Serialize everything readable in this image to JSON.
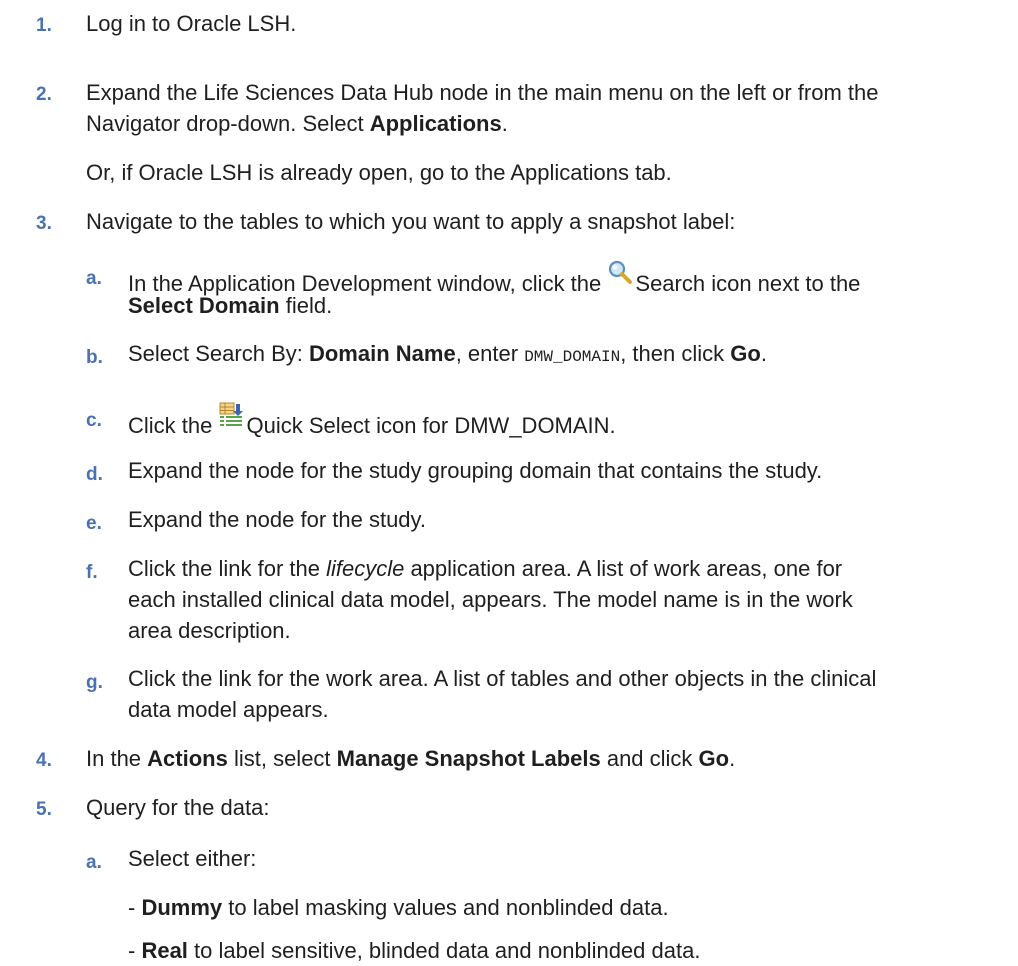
{
  "steps": [
    {
      "num": "1.",
      "text": "Log in to Oracle LSH."
    },
    {
      "num": "2.",
      "line1": "Expand the Life Sciences Data Hub node in the main menu on the left or from the",
      "line2_pre": "Navigator drop-down. Select ",
      "line2_bold": "Applications",
      "line2_post": ".",
      "extra": "Or, if Oracle LSH is already open, go to the Applications tab."
    },
    {
      "num": "3.",
      "text": "Navigate to the tables to which you want to apply a snapshot label:",
      "sub": {
        "a": {
          "label": "a.",
          "pre": "In the Application Development window, click the ",
          "icon_text": "Search icon next to the",
          "bold": "Select Domain",
          "post": " field.",
          "icon": "search-icon"
        },
        "b": {
          "label": "b.",
          "pre": "Select Search By: ",
          "bold1": "Domain Name",
          "mid": ", enter ",
          "code": "DMW_DOMAIN",
          "mid2": ", then click ",
          "bold2": "Go",
          "post": "."
        },
        "c": {
          "label": "c.",
          "pre": "Click the ",
          "post": "Quick Select icon for DMW_DOMAIN.",
          "icon": "quick-select-icon"
        },
        "d": {
          "label": "d.",
          "text": "Expand the node for the study grouping domain that contains the study."
        },
        "e": {
          "label": "e.",
          "text": "Expand the node for the study."
        },
        "f": {
          "label": "f.",
          "pre": "Click the link for the ",
          "italic": "lifecycle",
          "post": " application area. A list of work areas, one for",
          "line2": "each installed clinical data model, appears. The model name is in the work",
          "line3": "area description."
        },
        "g": {
          "label": "g.",
          "line1": "Click the link for the work area. A list of tables and other objects in the clinical",
          "line2": "data model appears."
        }
      }
    },
    {
      "num": "4.",
      "pre": "In the ",
      "bold1": "Actions",
      "mid": " list, select ",
      "bold2": "Manage Snapshot Labels",
      "mid2": " and click ",
      "bold3": "Go",
      "post": "."
    },
    {
      "num": "5.",
      "text": "Query for the data:",
      "sub": {
        "a": {
          "label": "a.",
          "text": "Select either:",
          "opt1_pre": "- ",
          "opt1_bold": "Dummy",
          "opt1_post": " to label masking values and nonblinded data.",
          "opt2_pre": "- ",
          "opt2_bold": "Real",
          "opt2_post": " to label sensitive, blinded data and nonblinded data."
        }
      }
    }
  ],
  "colors": {
    "number": "#4a72b0",
    "text": "#1f1f1f"
  }
}
